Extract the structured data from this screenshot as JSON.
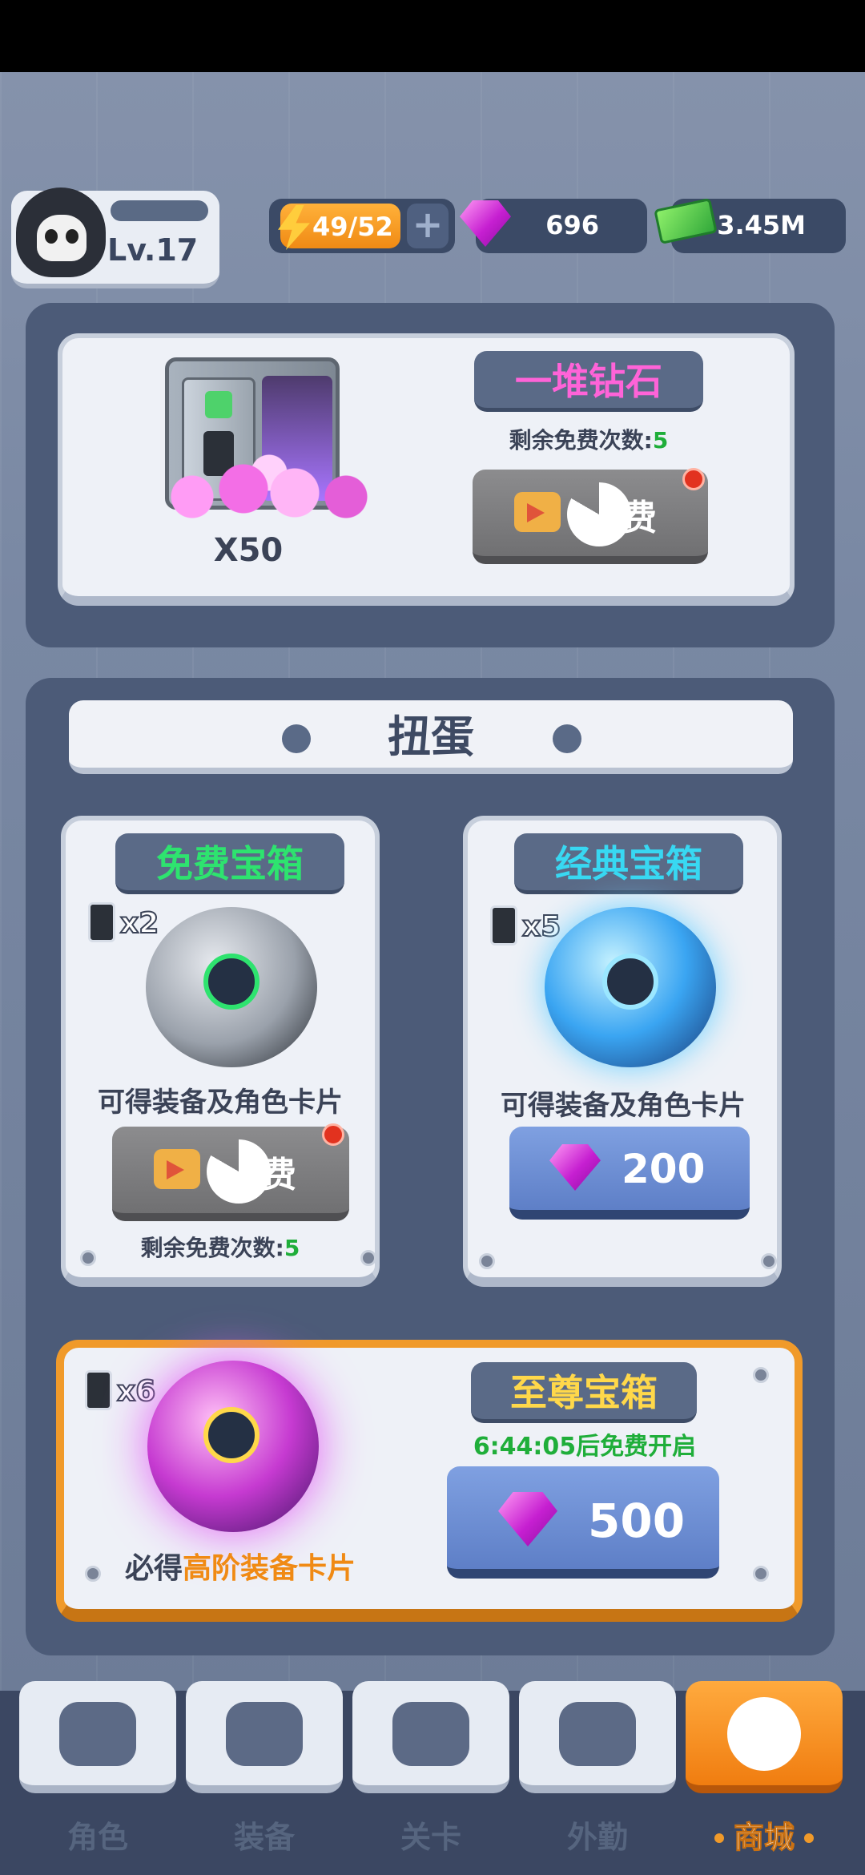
{
  "player": {
    "level": "Lv.17"
  },
  "resources": {
    "energy": "49/52",
    "gems": "696",
    "cash": "3.45M"
  },
  "diamond_offer": {
    "title": "一堆钻石",
    "amount": "X50",
    "remaining_label": "剩余免费次数:",
    "remaining_count": "5",
    "button_label": "费"
  },
  "gacha": {
    "header": "扭蛋",
    "free_box": {
      "title": "免费宝箱",
      "card_count": "x2",
      "description": "可得装备及角色卡片",
      "button_label": "费",
      "remaining_label": "剩余免费次数:",
      "remaining_count": "5"
    },
    "classic_box": {
      "title": "经典宝箱",
      "card_count": "x5",
      "description": "可得装备及角色卡片",
      "price": "200"
    },
    "supreme_box": {
      "title": "至尊宝箱",
      "card_count": "x6",
      "timer": "6:44:05后免费开启",
      "description_prefix": "必得",
      "description_highlight": "高阶装备卡片",
      "price": "500"
    }
  },
  "nav": [
    {
      "label": "角色",
      "icon": "skull-icon",
      "active": false
    },
    {
      "label": "装备",
      "icon": "gun-icon",
      "active": false
    },
    {
      "label": "关卡",
      "icon": "map-pin-icon",
      "active": false
    },
    {
      "label": "外勤",
      "icon": "van-icon",
      "active": false
    },
    {
      "label": "商城",
      "icon": "shop-icon",
      "active": true
    }
  ],
  "colors": {
    "diamond_title": "#ff63d8",
    "free_title": "#2ee36f",
    "classic_title": "#38d8f2",
    "supreme_title": "#ffd84a",
    "timer": "#1fae3a",
    "highlight": "#f08a14",
    "active_tab": "#f07d10"
  }
}
